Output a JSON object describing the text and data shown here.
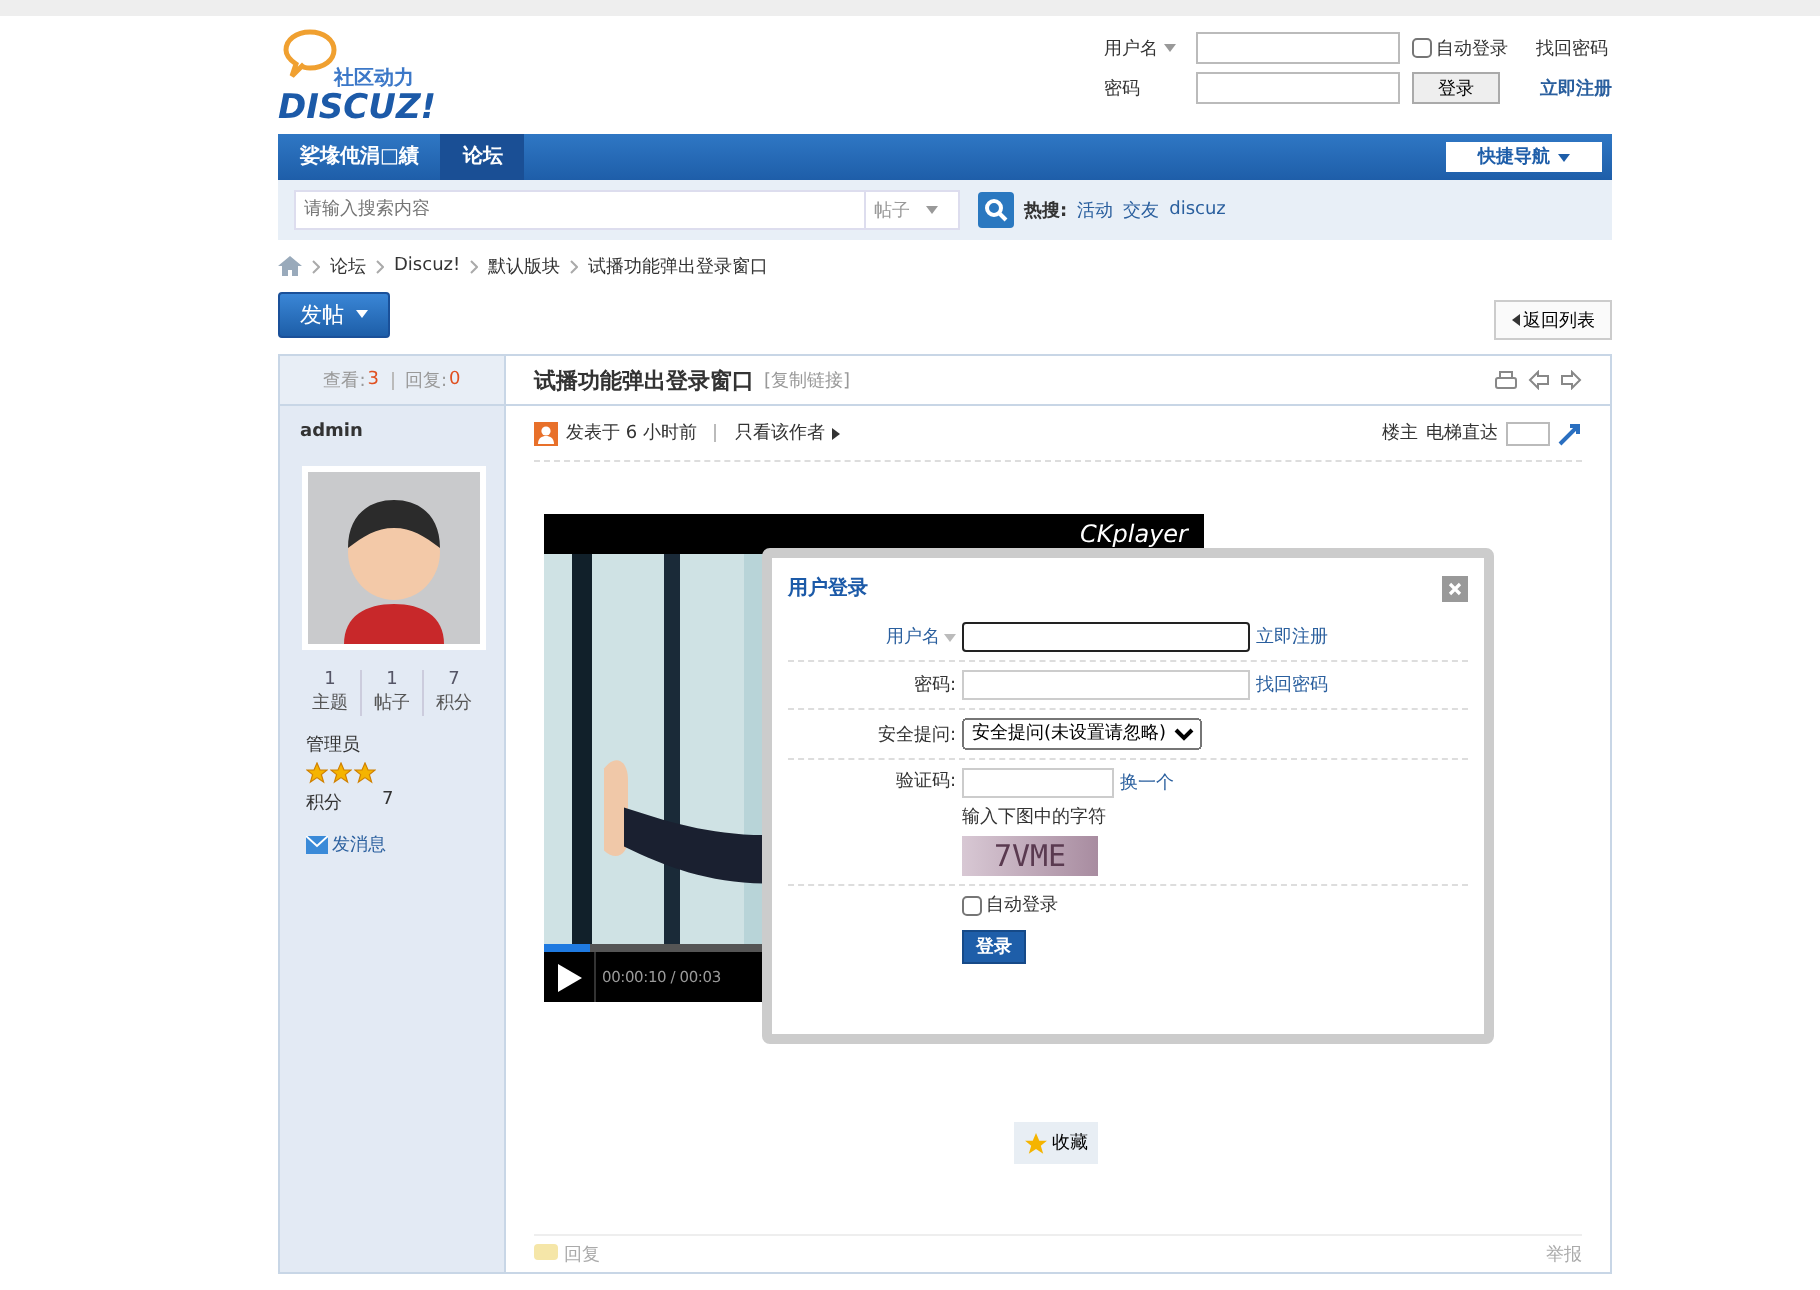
{
  "header": {
    "logo_tagline": "社区动力",
    "logo_text": "DISCUZ!",
    "login": {
      "username_label": "用户名",
      "password_label": "密码",
      "auto_login": {
        "label": "自动登录",
        "checked": false
      },
      "button": "登录",
      "forgot": "找回密码",
      "register": "立即注册"
    }
  },
  "nav": {
    "items": [
      {
        "label": "娑堟伅涓□績",
        "selected": false
      },
      {
        "label": "论坛",
        "selected": true
      }
    ],
    "quick_nav": "快捷导航"
  },
  "search": {
    "placeholder": "请输入搜索内容",
    "scope": "帖子",
    "hot_label": "热搜:",
    "hot": [
      "活动",
      "交友",
      "discuz"
    ]
  },
  "breadcrumb": [
    "论坛",
    "Discuz!",
    "默认版块",
    "试播功能弹出登录窗口"
  ],
  "post_button": "发帖",
  "back_button": "返回列表",
  "thread": {
    "views_label": "查看:",
    "views": "3",
    "replies_label": "回复:",
    "replies": "0",
    "title": "试播功能弹出登录窗口",
    "copy_link": "[复制链接]"
  },
  "author": {
    "name": "admin",
    "stats": [
      {
        "value": "1",
        "label": "主题"
      },
      {
        "value": "1",
        "label": "帖子"
      },
      {
        "value": "7",
        "label": "积分"
      }
    ],
    "group": "管理员",
    "stars": 3,
    "points_label": "积分",
    "points": "7",
    "message": "发消息"
  },
  "post": {
    "posted": "发表于 6 小时前",
    "only_author": "只看该作者",
    "floor": "楼主",
    "jump_label": "电梯直达"
  },
  "player": {
    "brand": "CKplayer",
    "time": "00:00:10 / 00:03",
    "level": 0.07
  },
  "favorite": "收藏",
  "reply": "回复",
  "report": "举报",
  "dialog": {
    "title": "用户登录",
    "username_label": "用户名",
    "register": "立即注册",
    "password_label": "密码:",
    "forgot": "找回密码",
    "question_label": "安全提问:",
    "question": "安全提问(未设置请忽略)",
    "captcha_label": "验证码:",
    "captcha_refresh": "换一个",
    "captcha_hint": "输入下图中的字符",
    "captcha": "7VME",
    "auto_login": {
      "label": "自动登录",
      "checked": false
    },
    "button": "登录"
  }
}
